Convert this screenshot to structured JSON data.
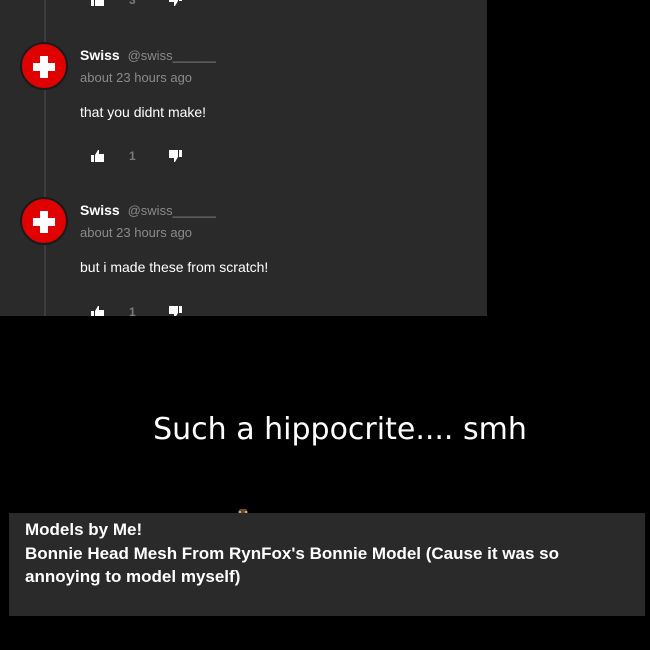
{
  "thread": {
    "top_partial": {
      "upvotes": "3"
    },
    "comments": [
      {
        "name": "Swiss",
        "handle": "@swiss______",
        "time": "about 23 hours ago",
        "text": "that you didnt make!",
        "upvotes": "1"
      },
      {
        "name": "Swiss",
        "handle": "@swiss______",
        "time": "about 23 hours ago",
        "text": "but i made these from scratch!",
        "upvotes": "1"
      }
    ]
  },
  "caption": "Such a hippocrite.... smh",
  "card": {
    "title": "Models by Me!",
    "description": "Bonnie Head Mesh From RynFox's Bonnie Model (Cause it was so annoying to model myself)"
  },
  "colors": {
    "avatar_red": "#e00000",
    "panel_bg": "#2a2a2a"
  },
  "icons": [
    "thumbs-up-icon",
    "thumbs-down-icon",
    "swiss-flag-icon"
  ]
}
